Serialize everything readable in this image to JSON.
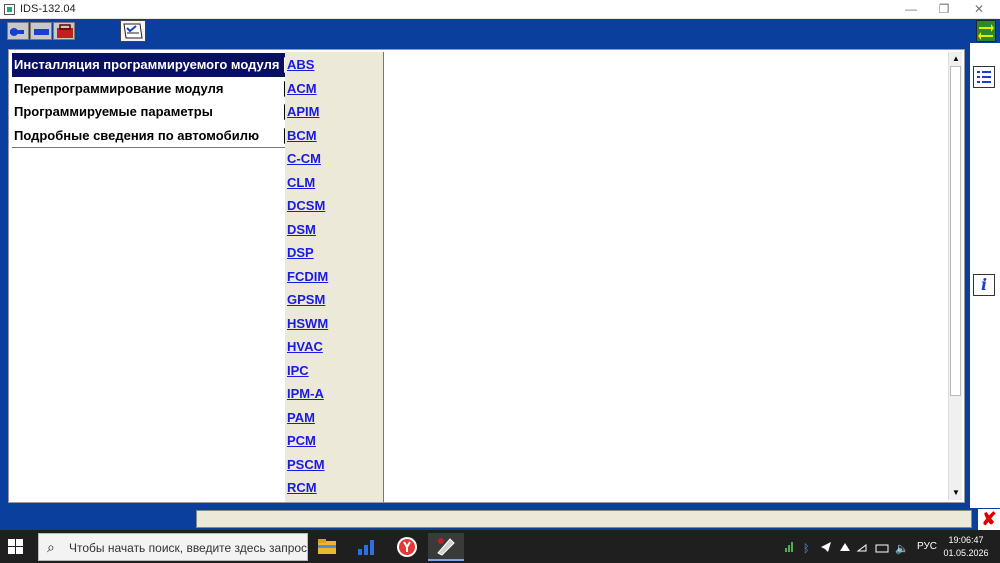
{
  "window": {
    "title": "IDS-132.04",
    "minimize_glyph": "—",
    "restore_glyph": "❐",
    "close_glyph": "✕"
  },
  "menu": {
    "items": [
      {
        "label": "Инсталляция программируемого модуля",
        "selected": true
      },
      {
        "label": "Перепрограммирование модуля",
        "selected": false
      },
      {
        "label": "Программируемые параметры",
        "selected": false
      },
      {
        "label": "Подробные сведения по автомобилю",
        "selected": false
      }
    ]
  },
  "modules": [
    "ABS",
    "ACM",
    "APIM",
    "BCM",
    "C-CM",
    "CLM",
    "DCSM",
    "DSM",
    "DSP",
    "FCDIM",
    "GPSM",
    "HSWM",
    "HVAC",
    "IPC",
    "IPM-A",
    "PAM",
    "PCM",
    "PSCM",
    "RCM"
  ],
  "side_panel": {
    "list_icon": "list-icon",
    "info_icon": "info-icon",
    "info_glyph": "i"
  },
  "statusbar": {
    "close_glyph": "✘"
  },
  "taskbar": {
    "search_placeholder": "Чтобы начать поиск, введите здесь запрос",
    "language": "РУС",
    "time": "19:06:47",
    "date": "01.05.2026"
  },
  "colors": {
    "frame_blue": "#0a3f9e",
    "selected_menu": "#0a1060",
    "link_blue": "#1a1ae0",
    "panel_beige": "#ece9d8"
  }
}
